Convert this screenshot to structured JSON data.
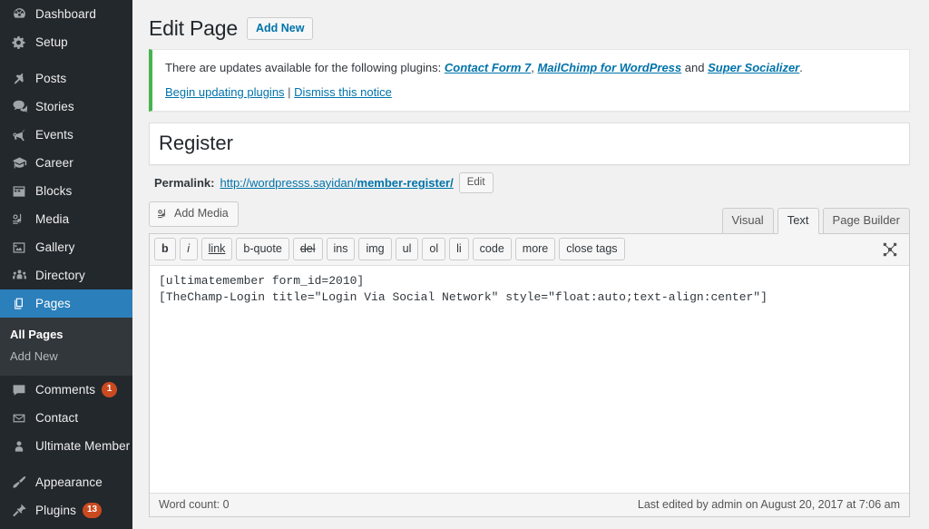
{
  "sidebar": {
    "items": [
      {
        "label": "Dashboard",
        "icon": "dashboard-icon",
        "name": "sidebar-item-dashboard",
        "badge": null,
        "active": false,
        "gap_before": false
      },
      {
        "label": "Setup",
        "icon": "gear-icon",
        "name": "sidebar-item-setup",
        "badge": null,
        "active": false,
        "gap_before": false
      },
      {
        "label": "Posts",
        "icon": "pin-icon",
        "name": "sidebar-item-posts",
        "badge": null,
        "active": false,
        "gap_before": true
      },
      {
        "label": "Stories",
        "icon": "comments-icon",
        "name": "sidebar-item-stories",
        "badge": null,
        "active": false,
        "gap_before": false
      },
      {
        "label": "Events",
        "icon": "megaphone-icon",
        "name": "sidebar-item-events",
        "badge": null,
        "active": false,
        "gap_before": false
      },
      {
        "label": "Career",
        "icon": "graduation-cap-icon",
        "name": "sidebar-item-career",
        "badge": null,
        "active": false,
        "gap_before": false
      },
      {
        "label": "Blocks",
        "icon": "grid-icon",
        "name": "sidebar-item-blocks",
        "badge": null,
        "active": false,
        "gap_before": false
      },
      {
        "label": "Media",
        "icon": "media-icon",
        "name": "sidebar-item-media",
        "badge": null,
        "active": false,
        "gap_before": false
      },
      {
        "label": "Gallery",
        "icon": "image-icon",
        "name": "sidebar-item-gallery",
        "badge": null,
        "active": false,
        "gap_before": false
      },
      {
        "label": "Directory",
        "icon": "groups-icon",
        "name": "sidebar-item-directory",
        "badge": null,
        "active": false,
        "gap_before": false
      },
      {
        "label": "Pages",
        "icon": "pages-icon",
        "name": "sidebar-item-pages",
        "badge": null,
        "active": true,
        "gap_before": false
      },
      {
        "label": "Comments",
        "icon": "comment-bubble-icon",
        "name": "sidebar-item-comments",
        "badge": "1",
        "active": false,
        "gap_before": false
      },
      {
        "label": "Contact",
        "icon": "envelope-icon",
        "name": "sidebar-item-contact",
        "badge": null,
        "active": false,
        "gap_before": false
      },
      {
        "label": "Ultimate Member",
        "icon": "user-icon",
        "name": "sidebar-item-ultimate-member",
        "badge": null,
        "active": false,
        "gap_before": false
      },
      {
        "label": "Appearance",
        "icon": "brush-icon",
        "name": "sidebar-item-appearance",
        "badge": null,
        "active": false,
        "gap_before": true
      },
      {
        "label": "Plugins",
        "icon": "plug-icon",
        "name": "sidebar-item-plugins",
        "badge": "13",
        "active": false,
        "gap_before": false
      }
    ],
    "submenu": {
      "parent": "Pages",
      "items": [
        {
          "label": "All Pages",
          "current": true,
          "name": "submenu-item-all-pages"
        },
        {
          "label": "Add New",
          "current": false,
          "name": "submenu-item-add-new"
        }
      ]
    },
    "colors": {
      "background": "#23282d",
      "submenu_background": "#32373c",
      "active": "#2b7fba",
      "badge": "#ca4a1f"
    }
  },
  "header": {
    "title": "Edit Page",
    "add_new_label": "Add New"
  },
  "notice": {
    "accent_color": "#46b450",
    "intro": "There are updates available for the following plugins:",
    "plugins": [
      "Contact Form 7",
      "MailChimp for WordPress",
      "Super Socializer"
    ],
    "conjunction": " and ",
    "comma": ", ",
    "period": ".",
    "action_begin": "Begin updating plugins",
    "action_separator": " | ",
    "action_dismiss": "Dismiss this notice"
  },
  "post": {
    "title_value": "Register",
    "title_placeholder": "Enter title here",
    "permalink_label": "Permalink:",
    "permalink_base": "http://wordpresss.sayidan/",
    "permalink_slug": "member-register/",
    "permalink_edit_label": "Edit"
  },
  "editor": {
    "add_media_label": "Add Media",
    "tabs": [
      {
        "label": "Visual",
        "active": false,
        "name": "tab-visual"
      },
      {
        "label": "Text",
        "active": true,
        "name": "tab-text"
      },
      {
        "label": "Page Builder",
        "active": false,
        "name": "tab-page-builder"
      }
    ],
    "quicktags": [
      {
        "label": "b",
        "style": "b",
        "name": "quicktag-bold"
      },
      {
        "label": "i",
        "style": "i",
        "name": "quicktag-italic"
      },
      {
        "label": "link",
        "style": "link",
        "name": "quicktag-link"
      },
      {
        "label": "b-quote",
        "style": "",
        "name": "quicktag-blockquote"
      },
      {
        "label": "del",
        "style": "del",
        "name": "quicktag-del"
      },
      {
        "label": "ins",
        "style": "",
        "name": "quicktag-ins"
      },
      {
        "label": "img",
        "style": "",
        "name": "quicktag-img"
      },
      {
        "label": "ul",
        "style": "",
        "name": "quicktag-ul"
      },
      {
        "label": "ol",
        "style": "",
        "name": "quicktag-ol"
      },
      {
        "label": "li",
        "style": "",
        "name": "quicktag-li"
      },
      {
        "label": "code",
        "style": "",
        "name": "quicktag-code"
      },
      {
        "label": "more",
        "style": "",
        "name": "quicktag-more"
      },
      {
        "label": "close tags",
        "style": "",
        "name": "quicktag-close-tags"
      }
    ],
    "content": "[ultimatemember form_id=2010]\n[TheChamp-Login title=\"Login Via Social Network\" style=\"float:auto;text-align:center\"]",
    "word_count": "Word count: 0",
    "last_edited": "Last edited by admin on August 20, 2017 at 7:06 am"
  }
}
